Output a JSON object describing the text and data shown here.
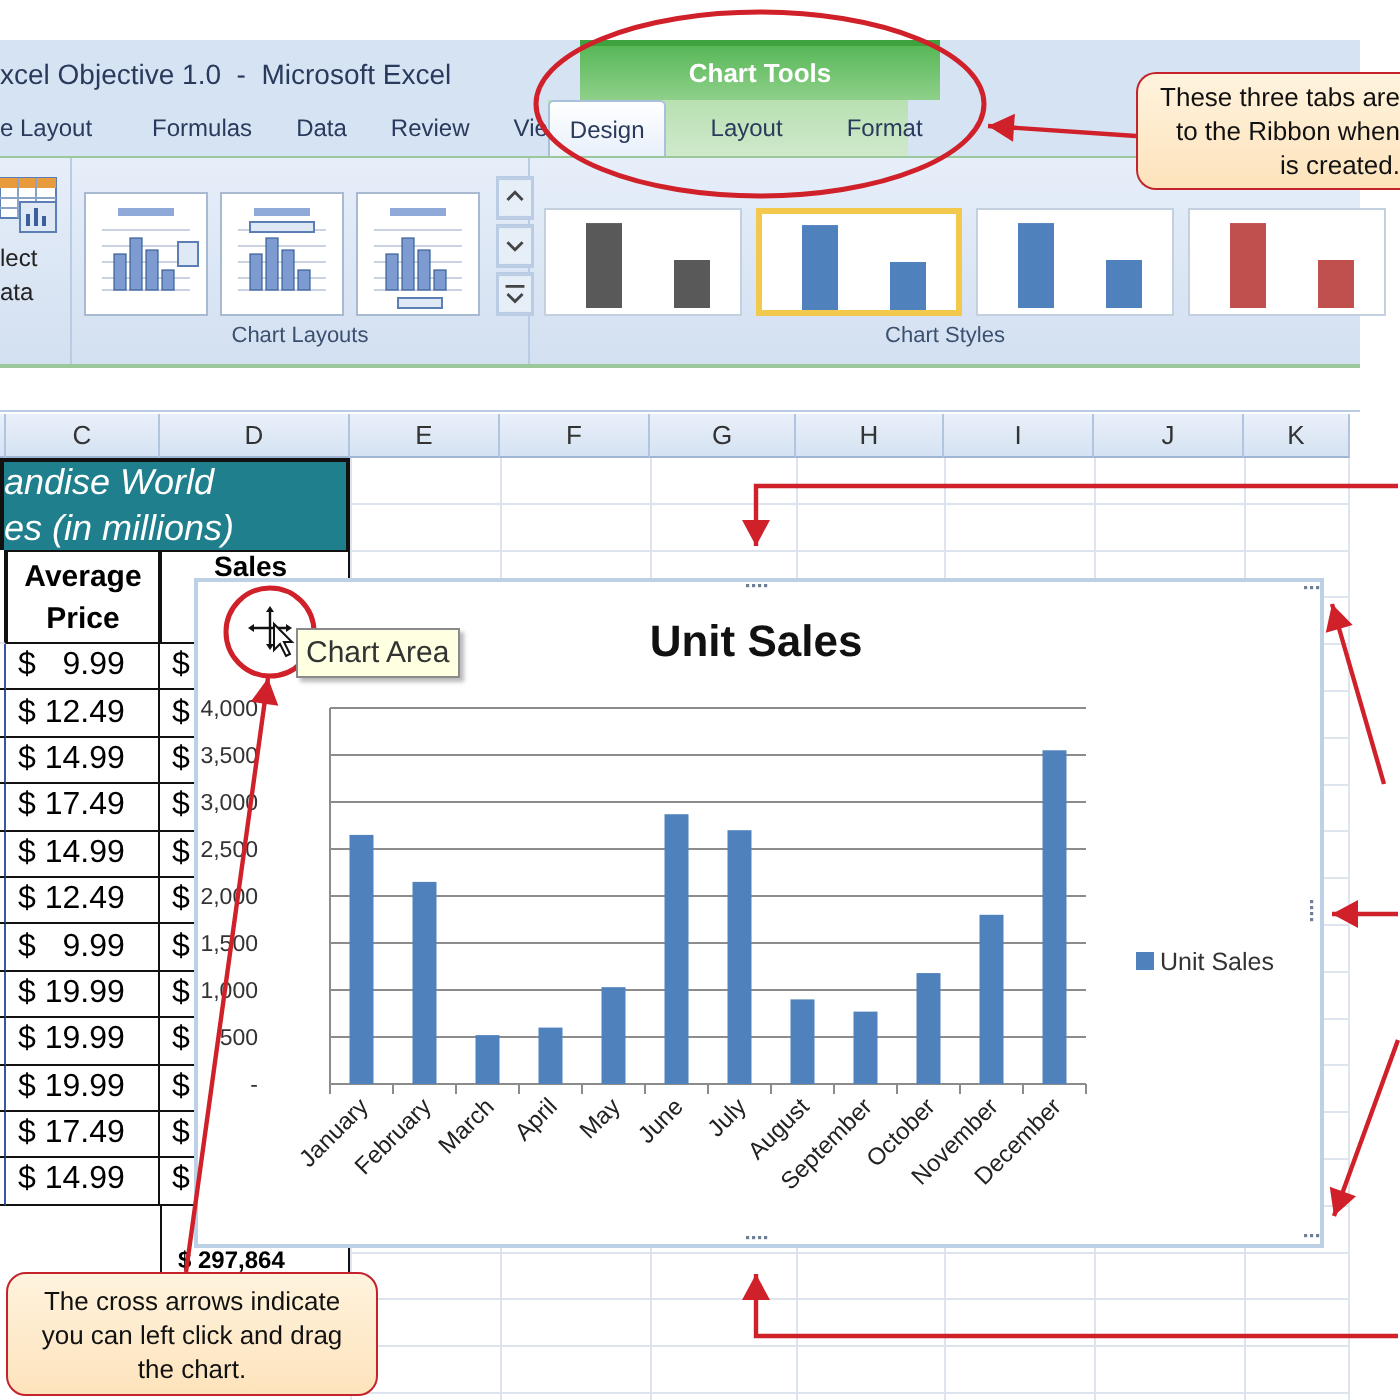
{
  "window": {
    "title": "xcel Objective 1.0  -  Microsoft Excel"
  },
  "contextual_group": {
    "title": "Chart Tools"
  },
  "tabs": [
    {
      "label": "e Layout",
      "selected": false,
      "contextual": false
    },
    {
      "label": "Formulas",
      "selected": false,
      "contextual": false
    },
    {
      "label": "Data",
      "selected": false,
      "contextual": false
    },
    {
      "label": "Review",
      "selected": false,
      "contextual": false
    },
    {
      "label": "Vie",
      "selected": false,
      "contextual": false
    },
    {
      "label": "Design",
      "selected": true,
      "contextual": true
    },
    {
      "label": "Layout",
      "selected": false,
      "contextual": true
    },
    {
      "label": "Format",
      "selected": false,
      "contextual": true
    }
  ],
  "ribbon": {
    "select_data_label": "lect ata",
    "groups": [
      {
        "label": "Chart Layouts"
      },
      {
        "label": "Chart Styles"
      }
    ],
    "chart_styles": [
      {
        "color": "#595959",
        "selected": false
      },
      {
        "color": "#4f81bd",
        "selected": true
      },
      {
        "color": "#4f81bd",
        "selected": false
      },
      {
        "color": "#c0504d",
        "selected": false
      }
    ]
  },
  "sheet": {
    "columns": [
      "C",
      "D",
      "E",
      "F",
      "G",
      "H",
      "I",
      "J",
      "K"
    ],
    "title_lines": [
      "andise World",
      "es (in millions)"
    ],
    "headers": [
      "Average Price",
      "Sales"
    ],
    "rows": [
      {
        "price": "$   9.99",
        "sales": "$"
      },
      {
        "price": "$ 12.49",
        "sales": "$"
      },
      {
        "price": "$ 14.99",
        "sales": "$"
      },
      {
        "price": "$ 17.49",
        "sales": "$"
      },
      {
        "price": "$ 14.99",
        "sales": "$"
      },
      {
        "price": "$ 12.49",
        "sales": "$"
      },
      {
        "price": "$   9.99",
        "sales": "$"
      },
      {
        "price": "$ 19.99",
        "sales": "$"
      },
      {
        "price": "$ 19.99",
        "sales": "$"
      },
      {
        "price": "$ 19.99",
        "sales": "$"
      },
      {
        "price": "$ 17.49",
        "sales": "$"
      },
      {
        "price": "$ 14.99",
        "sales": "$"
      }
    ],
    "total": "$ 297,864"
  },
  "chart": {
    "tooltip": "Chart Area",
    "chart_data": {
      "type": "bar",
      "title": "Unit Sales",
      "categories": [
        "January",
        "February",
        "March",
        "April",
        "May",
        "June",
        "July",
        "August",
        "September",
        "October",
        "November",
        "December"
      ],
      "series": [
        {
          "name": "Unit Sales",
          "color": "#4f81bd",
          "values": [
            2650,
            2150,
            520,
            600,
            1030,
            2870,
            2700,
            900,
            770,
            1180,
            1800,
            3550
          ]
        }
      ],
      "ylim": [
        0,
        4000
      ],
      "grid": true,
      "yticks": [
        {
          "value": 0,
          "label": "-"
        },
        {
          "value": 500,
          "label": "500"
        },
        {
          "value": 1000,
          "label": "1,000"
        },
        {
          "value": 1500,
          "label": "1,500"
        },
        {
          "value": 2000,
          "label": "2,000"
        },
        {
          "value": 2500,
          "label": "2,500"
        },
        {
          "value": 3000,
          "label": "3,000"
        },
        {
          "value": 3500,
          "label": "3,500"
        },
        {
          "value": 4000,
          "label": "4,000"
        }
      ]
    }
  },
  "callouts": [
    {
      "text": "These three tabs are\nto the Ribbon when\nis created."
    },
    {
      "text": "The cross arrows indicate you can left click and drag the chart."
    }
  ]
}
